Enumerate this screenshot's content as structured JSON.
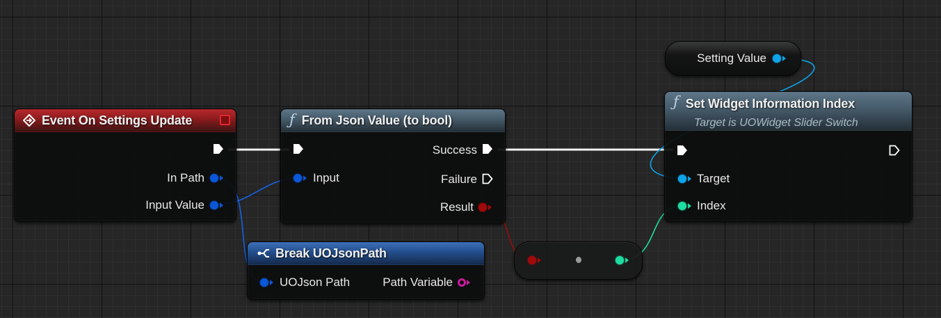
{
  "nodes": {
    "event": {
      "title": "Event On Settings Update",
      "pins": {
        "in_path": "In Path",
        "input_value": "Input Value"
      }
    },
    "from_json": {
      "title": "From Json Value (to bool)",
      "pins": {
        "input": "Input",
        "success": "Success",
        "failure": "Failure",
        "result": "Result"
      }
    },
    "break_path": {
      "title": "Break UOJsonPath",
      "pins": {
        "uojson_path": "UOJson Path",
        "path_variable": "Path Variable"
      }
    },
    "set_widget": {
      "title": "Set Widget Information Index",
      "subtitle": "Target is UOWidget Slider Switch",
      "pins": {
        "target": "Target",
        "index": "Index"
      }
    },
    "setting_value": {
      "label": "Setting Value"
    }
  },
  "colors": {
    "exec": "#ffffff",
    "struct_pin": "#0a57d9",
    "object_pin": "#0da4ea",
    "bool_pin": "#a10a0a",
    "int_pin": "#1ddc9f",
    "name_pin": "#cb1a9f",
    "event_header": "#b8292c",
    "function_header": "#4e6677",
    "break_header": "#2a5ba3"
  },
  "icons": {
    "event": "event-diamond-icon",
    "function": "function-icon",
    "break": "break-struct-icon",
    "delegate": "delegate-pin-icon"
  }
}
